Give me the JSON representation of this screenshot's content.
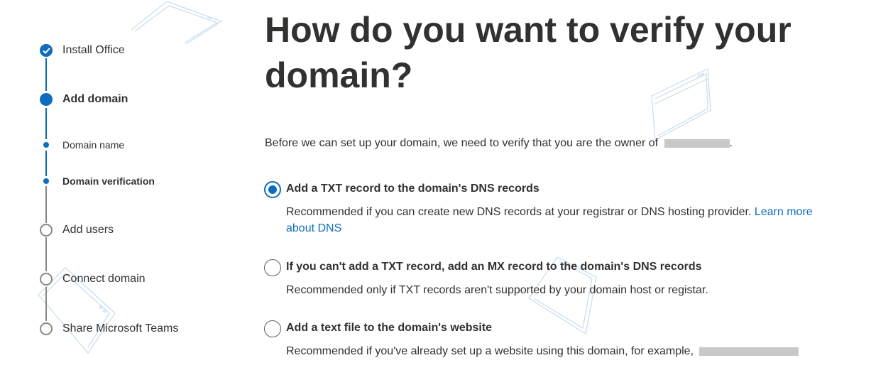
{
  "stepper": {
    "steps": [
      {
        "label": "Install Office",
        "state": "done"
      },
      {
        "label": "Add domain",
        "state": "current"
      },
      {
        "label": "Domain name",
        "state": "sub"
      },
      {
        "label": "Domain verification",
        "state": "sub-current"
      },
      {
        "label": "Add users",
        "state": "todo"
      },
      {
        "label": "Connect domain",
        "state": "todo"
      },
      {
        "label": "Share Microsoft Teams",
        "state": "todo"
      }
    ]
  },
  "main": {
    "title": "How do you want to verify your domain?",
    "intro_prefix": "Before we can set up your domain, we need to verify that you are the owner of ",
    "intro_suffix": ".",
    "options": [
      {
        "title": "Add a TXT record to the domain's DNS records",
        "description": "Recommended if you can create new DNS records at your registrar or DNS hosting provider. ",
        "link": "Learn more about DNS",
        "selected": true
      },
      {
        "title": "If you can't add a TXT record, add an MX record to the domain's DNS records",
        "description": "Recommended only if TXT records aren't supported by your domain host or registar.",
        "selected": false
      },
      {
        "title": "Add a text file to the domain's website",
        "description": "Recommended if you've already set up a website using this domain, for example, ",
        "selected": false
      }
    ]
  },
  "colors": {
    "accent": "#0f6cbd",
    "text": "#323130",
    "inactive": "#8a8886"
  },
  "icons": [
    "checkmark-icon"
  ]
}
